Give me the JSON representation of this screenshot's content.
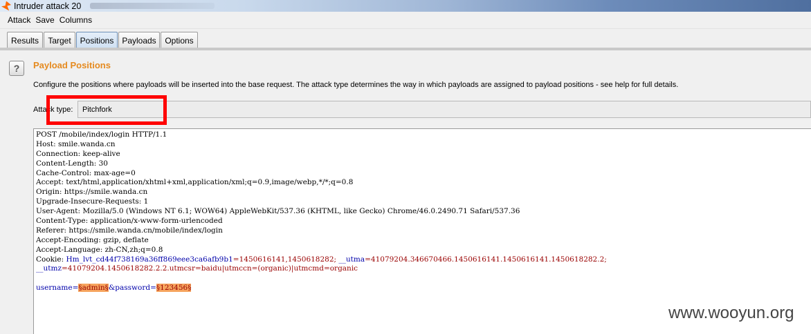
{
  "window": {
    "title": "Intruder attack 20"
  },
  "menu": [
    "Attack",
    "Save",
    "Columns"
  ],
  "tabs": [
    {
      "label": "Results"
    },
    {
      "label": "Target"
    },
    {
      "label": "Positions",
      "active": true
    },
    {
      "label": "Payloads"
    },
    {
      "label": "Options"
    }
  ],
  "section": {
    "help_icon": "?",
    "title": "Payload Positions",
    "description": "Configure the positions where payloads will be inserted into the base request. The attack type determines the way in which payloads are assigned to payload positions - see help for full details."
  },
  "attack_type": {
    "label": "Attack type:",
    "value": "Pitchfork"
  },
  "request": {
    "lines": [
      "POST /mobile/index/login HTTP/1.1",
      "Host: smile.wanda.cn",
      "Connection: keep-alive",
      "Content-Length: 30",
      "Cache-Control: max-age=0",
      "Accept: text/html,application/xhtml+xml,application/xml;q=0.9,image/webp,*/*;q=0.8",
      "Origin: https://smile.wanda.cn",
      "Upgrade-Insecure-Requests: 1",
      "User-Agent: Mozilla/5.0 (Windows NT 6.1; WOW64) AppleWebKit/537.36 (KHTML, like Gecko) Chrome/46.0.2490.71 Safari/537.36",
      "Content-Type: application/x-www-form-urlencoded",
      "Referer: https://smile.wanda.cn/mobile/index/login",
      "Accept-Encoding: gzip, deflate",
      "Accept-Language: zh-CN,zh;q=0.8"
    ],
    "cookie_prefix": "Cookie: ",
    "cookie_1_name": "Hm_lvt_cd44f738169a36ff869eee3ca6afb9b1",
    "cookie_1_value": "=1450616141,1450618282; ",
    "cookie_2_name": "__utma",
    "cookie_2_value": "=41079204.346670466.1450616141.1450616141.1450618282.2;",
    "cookie_3_name": "__utmz",
    "cookie_3_value": "=41079204.1450618282.2.2.utmcsr=baidu|utmccn=(organic)|utmcmd=organic",
    "body_param_1": "username=",
    "body_marker_1": "§admin§",
    "body_param_2": "&password=",
    "body_marker_2": "§123456§"
  },
  "watermark": "www.wooyun.org",
  "colors": {
    "title_accent": "#e58a1f",
    "highlight_box": "#ff0000",
    "payload_marker": "#f6a45e"
  }
}
